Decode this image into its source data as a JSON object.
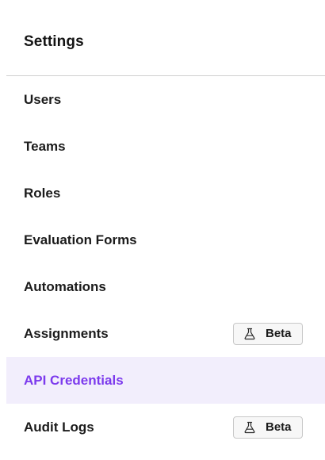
{
  "header": {
    "title": "Settings"
  },
  "nav": {
    "items": [
      {
        "label": "Users",
        "active": false,
        "badge": null
      },
      {
        "label": "Teams",
        "active": false,
        "badge": null
      },
      {
        "label": "Roles",
        "active": false,
        "badge": null
      },
      {
        "label": "Evaluation Forms",
        "active": false,
        "badge": null
      },
      {
        "label": "Automations",
        "active": false,
        "badge": null
      },
      {
        "label": "Assignments",
        "active": false,
        "badge": {
          "icon": "flask-icon",
          "label": "Beta"
        }
      },
      {
        "label": "API Credentials",
        "active": true,
        "badge": null
      },
      {
        "label": "Audit Logs",
        "active": false,
        "badge": {
          "icon": "flask-icon",
          "label": "Beta"
        }
      }
    ]
  },
  "colors": {
    "active_background": "#f2eefc",
    "active_text": "#7c3aed",
    "divider": "#cfcfcf",
    "badge_border": "#c8c8c8",
    "badge_background": "#f7f7f7"
  }
}
